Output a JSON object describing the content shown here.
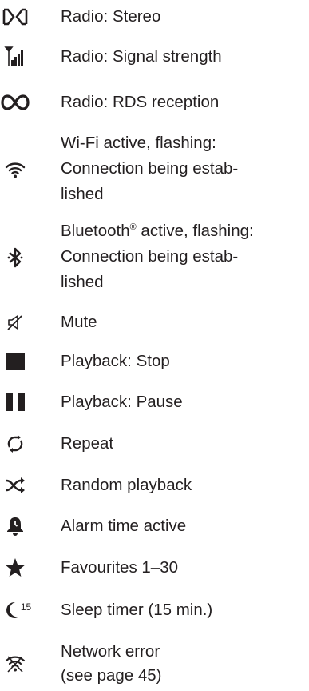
{
  "legend": {
    "items": [
      {
        "icon": "stereo-icon",
        "label": "Radio: Stereo"
      },
      {
        "icon": "signal-strength-icon",
        "label": "Radio: Signal strength"
      },
      {
        "icon": "rds-icon",
        "label": "Radio: RDS reception"
      },
      {
        "icon": "wifi-icon",
        "label": "Wi-Fi active, flashing:\nConnection being estab-\nlished"
      },
      {
        "icon": "bluetooth-icon",
        "label_pre": "Bluetooth",
        "label_sup": "®",
        "label_post": " active, flashing:\nConnection being estab-\nlished"
      },
      {
        "icon": "mute-icon",
        "label": "Mute"
      },
      {
        "icon": "stop-icon",
        "label": "Playback: Stop"
      },
      {
        "icon": "pause-icon",
        "label": "Playback: Pause"
      },
      {
        "icon": "repeat-icon",
        "label": "Repeat"
      },
      {
        "icon": "shuffle-icon",
        "label": "Random playback"
      },
      {
        "icon": "alarm-icon",
        "label": "Alarm time active"
      },
      {
        "icon": "star-icon",
        "label": "Favourites 1–30"
      },
      {
        "icon": "sleep-timer-icon",
        "label": "Sleep timer (15 min.)",
        "icon_text": "15"
      },
      {
        "icon": "network-error-icon",
        "label": "Network error\n(see page 45)"
      }
    ]
  },
  "colors": {
    "text": "#231f20",
    "icon": "#231f20"
  }
}
